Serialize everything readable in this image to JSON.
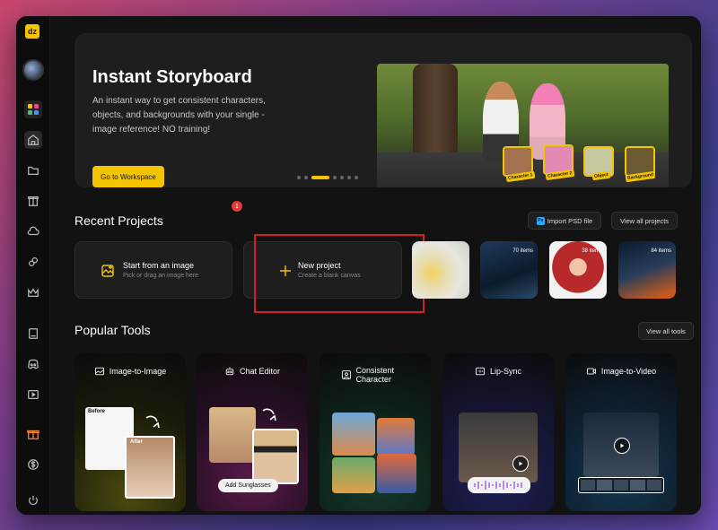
{
  "app": {
    "logo": "dz"
  },
  "sidebar": {
    "items": [
      {
        "name": "home-icon"
      },
      {
        "name": "folder-icon"
      },
      {
        "name": "box-icon"
      },
      {
        "name": "cloud-icon"
      },
      {
        "name": "link-icon"
      },
      {
        "name": "crown-icon"
      },
      {
        "name": "book-icon"
      },
      {
        "name": "discord-icon"
      },
      {
        "name": "play-icon"
      },
      {
        "name": "gift-icon"
      },
      {
        "name": "dollar-icon"
      },
      {
        "name": "power-icon"
      }
    ]
  },
  "hero": {
    "title": "Instant Storyboard",
    "description": "An instant way to get consistent characters, objects, and backgrounds with your single - image reference! NO training!",
    "button": "Go to Workspace",
    "tags": [
      "Character 1",
      "Character 2",
      "Object",
      "Background"
    ]
  },
  "recent": {
    "title": "Recent Projects",
    "import_btn": "Import PSD file",
    "ps_badge": "Ps",
    "view_all": "View all projects",
    "notification_count": "1",
    "start_image_title": "Start from an image",
    "start_image_sub": "Pick or drag an image here",
    "new_project_title": "New project",
    "new_project_sub": "Create a blank canvas",
    "thumbs": [
      {
        "count": ""
      },
      {
        "count": "70 items"
      },
      {
        "count": "38 items"
      },
      {
        "count": "84 items"
      }
    ]
  },
  "tools": {
    "title": "Popular Tools",
    "view_all": "View all tools",
    "items": [
      {
        "label": "Image-to-Image",
        "badge_before": "Before",
        "badge_after": "After"
      },
      {
        "label": "Chat Editor",
        "chip": "Add Sunglasses"
      },
      {
        "label": "Consistent Character"
      },
      {
        "label": "Lip-Sync"
      },
      {
        "label": "Image-to-Video"
      }
    ]
  },
  "colors": {
    "accent": "#f5c400",
    "highlight": "#d0202a",
    "badge": "#e43b3b"
  }
}
